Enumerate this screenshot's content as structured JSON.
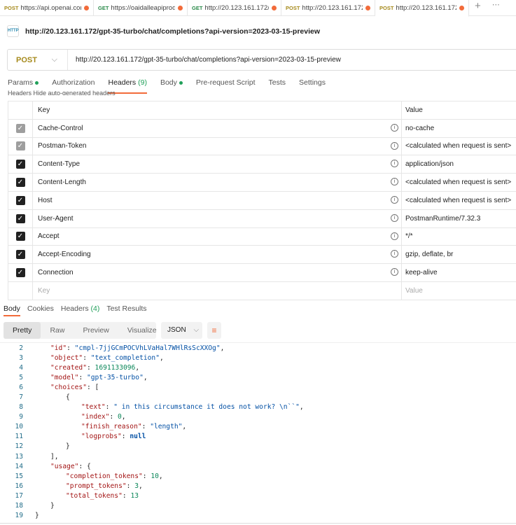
{
  "tabs": [
    {
      "method": "POST",
      "url": "https://api.openai.cor"
    },
    {
      "method": "GET",
      "url": "https://oaidalleapiprod"
    },
    {
      "method": "GET",
      "url": "http://20.123.161.172/he"
    },
    {
      "method": "POST",
      "url": "http://20.123.161.172/g"
    },
    {
      "method": "POST",
      "url": "http://20.123.161.172/g"
    }
  ],
  "request": {
    "icon_label": "HTTP",
    "title": "http://20.123.161.172/gpt-35-turbo/chat/completions?api-version=2023-03-15-preview",
    "method": "POST",
    "url": "http://20.123.161.172/gpt-35-turbo/chat/completions?api-version=2023-03-15-preview"
  },
  "request_tabs": {
    "params": "Params",
    "authorization": "Authorization",
    "headers": "Headers",
    "headers_count": "(9)",
    "body": "Body",
    "prerequest": "Pre-request Script",
    "tests": "Tests",
    "settings": "Settings"
  },
  "hidden_headers": "Headers   Hide auto-generated headers",
  "headers_table": {
    "key_col": "Key",
    "value_col": "Value",
    "rows": [
      {
        "key": "Cache-Control",
        "value": "no-cache",
        "disabled": true
      },
      {
        "key": "Postman-Token",
        "value": "<calculated when request is sent>",
        "disabled": true
      },
      {
        "key": "Content-Type",
        "value": "application/json",
        "disabled": false
      },
      {
        "key": "Content-Length",
        "value": "<calculated when request is sent>",
        "disabled": false
      },
      {
        "key": "Host",
        "value": "<calculated when request is sent>",
        "disabled": false
      },
      {
        "key": "User-Agent",
        "value": "PostmanRuntime/7.32.3",
        "disabled": false
      },
      {
        "key": "Accept",
        "value": "*/*",
        "disabled": false
      },
      {
        "key": "Accept-Encoding",
        "value": "gzip, deflate, br",
        "disabled": false
      },
      {
        "key": "Connection",
        "value": "keep-alive",
        "disabled": false
      }
    ],
    "key_placeholder": "Key",
    "value_placeholder": "Value"
  },
  "response_tabs": {
    "body": "Body",
    "cookies": "Cookies",
    "headers": "Headers",
    "headers_count": "(4)",
    "tests": "Test Results"
  },
  "view_modes": [
    "Pretty",
    "Raw",
    "Preview",
    "Visualize"
  ],
  "format": "JSON",
  "code_lines": [
    {
      "n": "2",
      "i": 1,
      "parts": [
        [
          "key",
          "\"id\""
        ],
        [
          "p",
          ": "
        ],
        [
          "str",
          "\"cmpl-7jjGCmPOCVhLVaHal7WHlRsScXXOg\""
        ],
        [
          "p",
          ","
        ]
      ]
    },
    {
      "n": "3",
      "i": 1,
      "parts": [
        [
          "key",
          "\"object\""
        ],
        [
          "p",
          ": "
        ],
        [
          "str",
          "\"text_completion\""
        ],
        [
          "p",
          ","
        ]
      ]
    },
    {
      "n": "4",
      "i": 1,
      "parts": [
        [
          "key",
          "\"created\""
        ],
        [
          "p",
          ": "
        ],
        [
          "num",
          "1691133096"
        ],
        [
          "p",
          ","
        ]
      ]
    },
    {
      "n": "5",
      "i": 1,
      "parts": [
        [
          "key",
          "\"model\""
        ],
        [
          "p",
          ": "
        ],
        [
          "str",
          "\"gpt-35-turbo\""
        ],
        [
          "p",
          ","
        ]
      ]
    },
    {
      "n": "6",
      "i": 1,
      "parts": [
        [
          "key",
          "\"choices\""
        ],
        [
          "p",
          ": ["
        ]
      ]
    },
    {
      "n": "7",
      "i": 2,
      "parts": [
        [
          "p",
          "{"
        ]
      ]
    },
    {
      "n": "8",
      "i": 3,
      "parts": [
        [
          "key",
          "\"text\""
        ],
        [
          "p",
          ": "
        ],
        [
          "str",
          "\" in this circumstance it does not work? \\n``\""
        ],
        [
          "p",
          ","
        ]
      ]
    },
    {
      "n": "9",
      "i": 3,
      "parts": [
        [
          "key",
          "\"index\""
        ],
        [
          "p",
          ": "
        ],
        [
          "num",
          "0"
        ],
        [
          "p",
          ","
        ]
      ]
    },
    {
      "n": "10",
      "i": 3,
      "parts": [
        [
          "key",
          "\"finish_reason\""
        ],
        [
          "p",
          ": "
        ],
        [
          "str",
          "\"length\""
        ],
        [
          "p",
          ","
        ]
      ]
    },
    {
      "n": "11",
      "i": 3,
      "parts": [
        [
          "key",
          "\"logprobs\""
        ],
        [
          "p",
          ": "
        ],
        [
          "nul",
          "null"
        ]
      ]
    },
    {
      "n": "12",
      "i": 2,
      "parts": [
        [
          "p",
          "}"
        ]
      ]
    },
    {
      "n": "13",
      "i": 1,
      "parts": [
        [
          "p",
          "],"
        ]
      ]
    },
    {
      "n": "14",
      "i": 1,
      "parts": [
        [
          "key",
          "\"usage\""
        ],
        [
          "p",
          ": {"
        ]
      ]
    },
    {
      "n": "15",
      "i": 2,
      "parts": [
        [
          "key",
          "\"completion_tokens\""
        ],
        [
          "p",
          ": "
        ],
        [
          "num",
          "10"
        ],
        [
          "p",
          ","
        ]
      ]
    },
    {
      "n": "16",
      "i": 2,
      "parts": [
        [
          "key",
          "\"prompt_tokens\""
        ],
        [
          "p",
          ": "
        ],
        [
          "num",
          "3"
        ],
        [
          "p",
          ","
        ]
      ]
    },
    {
      "n": "17",
      "i": 2,
      "parts": [
        [
          "key",
          "\"total_tokens\""
        ],
        [
          "p",
          ": "
        ],
        [
          "num",
          "13"
        ]
      ]
    },
    {
      "n": "18",
      "i": 1,
      "parts": [
        [
          "p",
          "}"
        ]
      ]
    },
    {
      "n": "19",
      "i": 0,
      "parts": [
        [
          "p",
          "}"
        ]
      ]
    }
  ]
}
